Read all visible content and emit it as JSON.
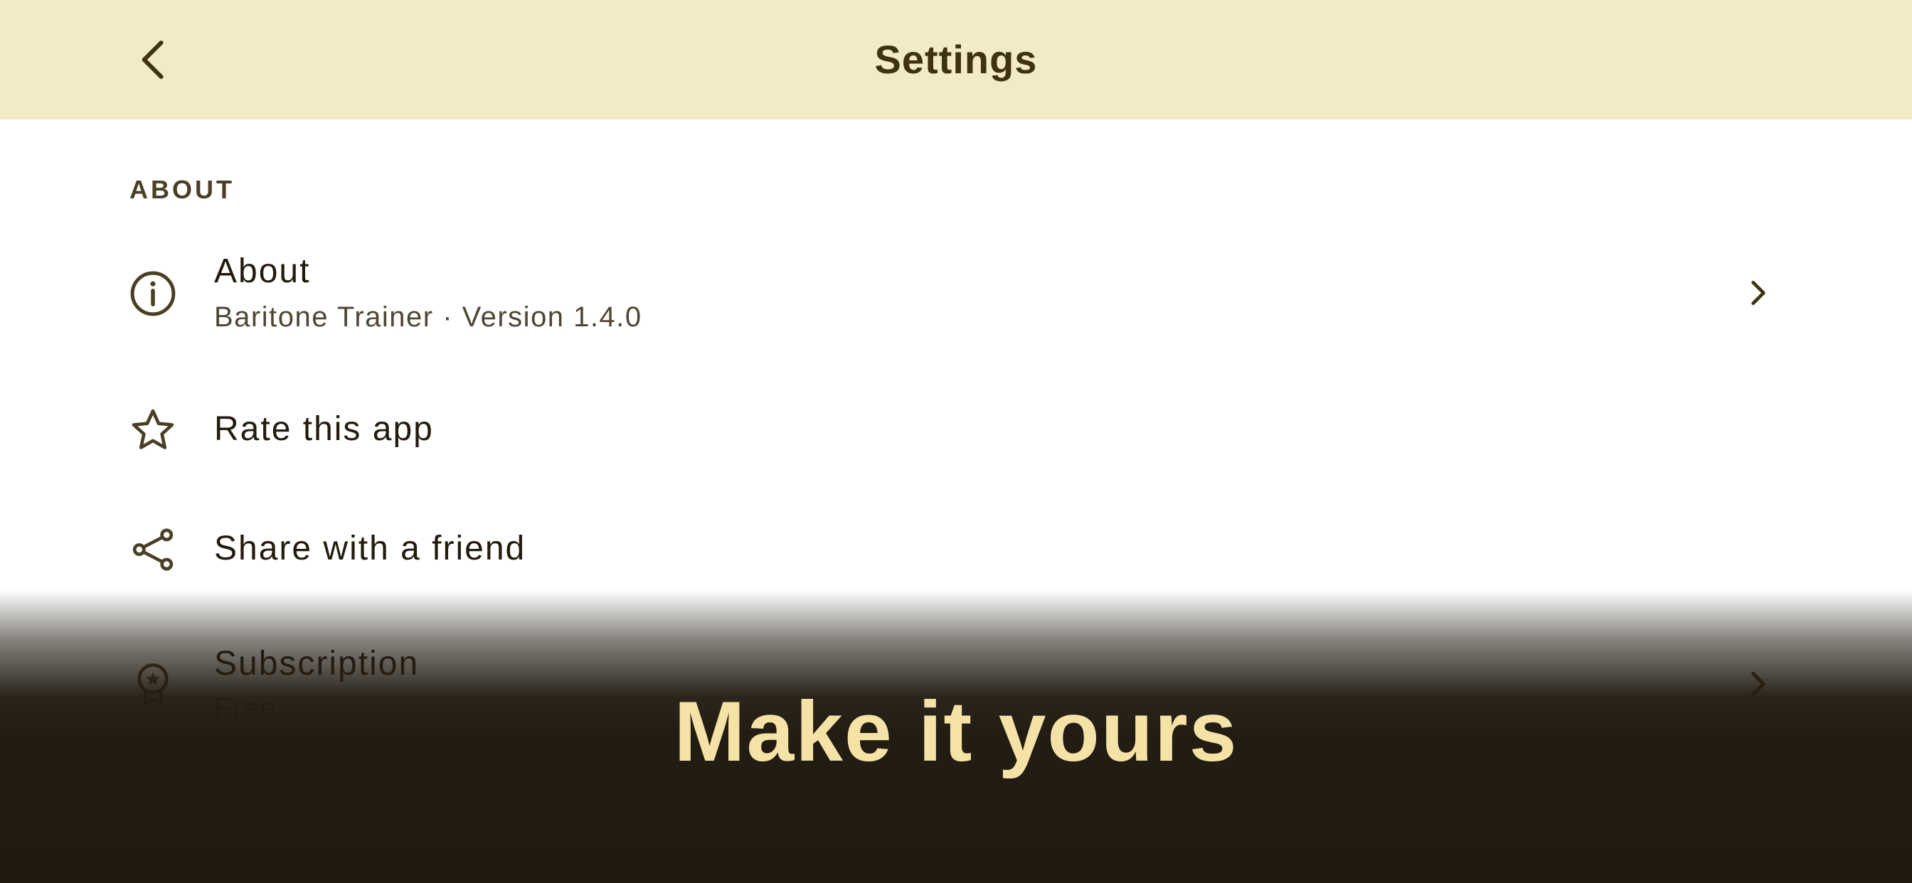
{
  "header": {
    "title": "Settings",
    "back_icon": "chevron-left-icon"
  },
  "section": {
    "label": "ABOUT"
  },
  "items": [
    {
      "icon": "info-icon",
      "title": "About",
      "subtitle": "Baritone Trainer · Version 1.4.0",
      "has_chevron": true
    },
    {
      "icon": "star-icon",
      "title": "Rate this app",
      "has_chevron": false
    },
    {
      "icon": "share-icon",
      "title": "Share with a friend",
      "has_chevron": false
    },
    {
      "icon": "badge-icon",
      "title": "Subscription",
      "subtitle": "Free",
      "has_chevron": true
    }
  ],
  "overlay": {
    "tagline": "Make it yours"
  },
  "colors": {
    "header_bg": "#f3eac6",
    "header_text": "#3d3310",
    "icon": "#4a3f24",
    "overlay_bg": "#221c12",
    "tagline": "#f5e2a6"
  }
}
